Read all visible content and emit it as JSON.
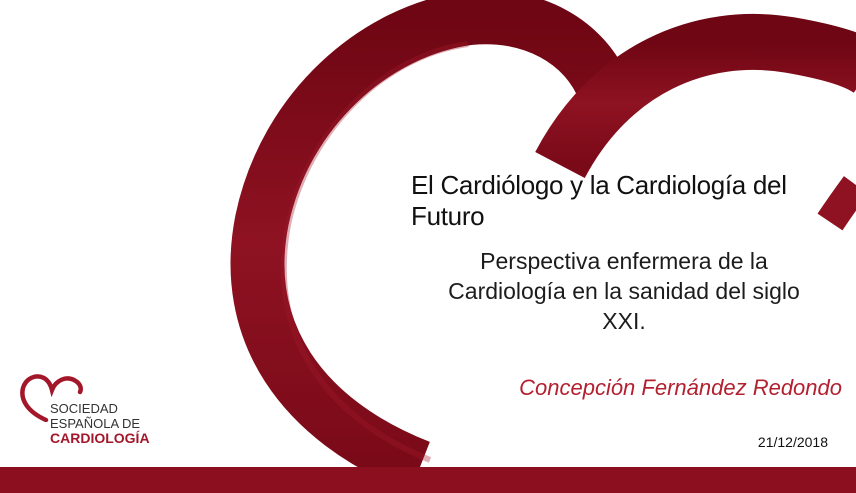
{
  "slide": {
    "title": "El Cardiólogo y la Cardiología del Futuro",
    "subtitle_line1": "Perspectiva enfermera de la",
    "subtitle_line2": "Cardiología en la sanidad del siglo",
    "subtitle_line3": "XXI.",
    "author": "Concepción Fernández Redondo",
    "date": "21/12/2018"
  },
  "logo": {
    "line1": "SOCIEDAD",
    "line2": "ESPAÑOLA DE",
    "line3": "CARDIOLOGÍA",
    "icon": "heart-outline-icon"
  },
  "colors": {
    "brand_red": "#8b0f1e",
    "author_red": "#b3202f",
    "text": "#111111"
  }
}
